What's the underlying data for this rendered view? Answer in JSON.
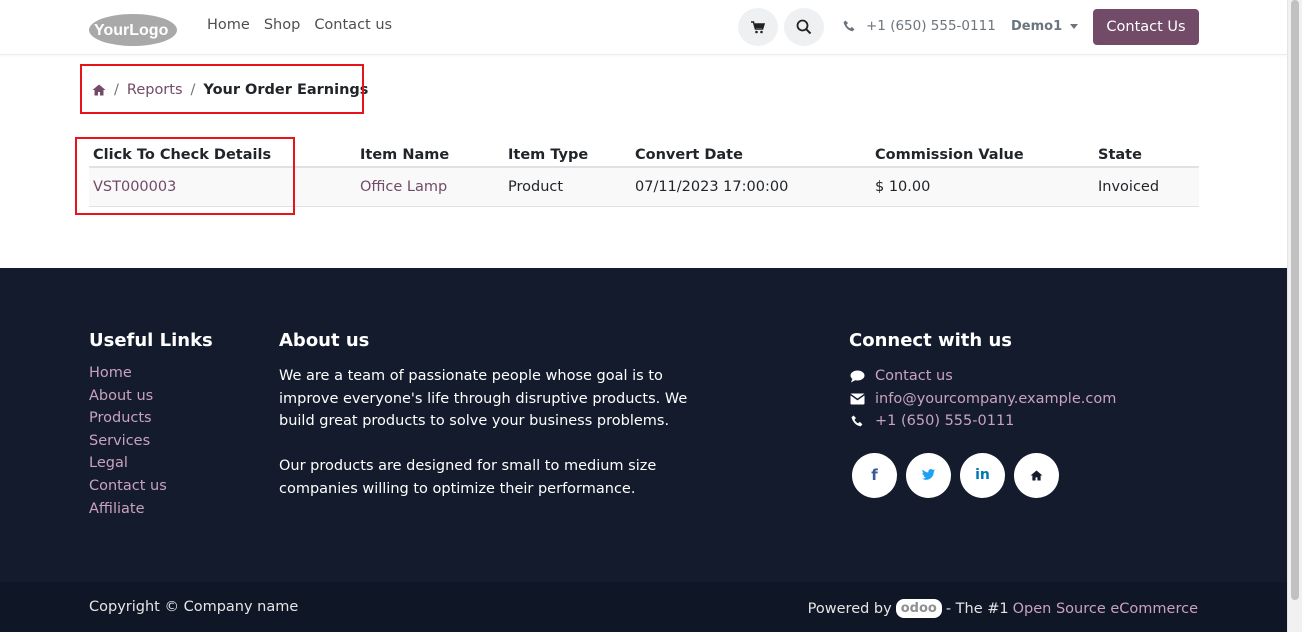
{
  "header": {
    "logo_text": "YourLogo",
    "nav": [
      "Home",
      "Shop",
      "Contact us"
    ],
    "phone": "+1 (650) 555-0111",
    "user": "Demo1",
    "contact_button": "Contact Us"
  },
  "breadcrumb": {
    "items": [
      "Reports",
      "Your Order Earnings"
    ]
  },
  "table": {
    "headers": [
      "Click To Check Details",
      "Item Name",
      "Item Type",
      "Convert Date",
      "Commission Value",
      "State"
    ],
    "rows": [
      [
        "VST000003",
        "Office Lamp",
        "Product",
        "07/11/2023 17:00:00",
        "$ 10.00",
        "Invoiced"
      ]
    ]
  },
  "footer": {
    "useful_links": {
      "title": "Useful Links",
      "items": [
        "Home",
        "About us",
        "Products",
        "Services",
        "Legal",
        "Contact us",
        "Affiliate"
      ]
    },
    "about": {
      "title": "About us",
      "p1": "We are a team of passionate people whose goal is to improve everyone's life through disruptive products. We build great products to solve your business problems.",
      "p2": "Our products are designed for small to medium size companies willing to optimize their performance."
    },
    "connect": {
      "title": "Connect with us",
      "contact": "Contact us",
      "email": "info@yourcompany.example.com",
      "phone": "+1 (650) 555-0111"
    },
    "socials": {
      "facebook": "f",
      "linkedin": "in"
    }
  },
  "copyright": {
    "text": "Copyright © Company name",
    "powered_by": "Powered by",
    "odoo": "odoo",
    "the1": "- The #1",
    "ecommerce": "Open Source eCommerce"
  },
  "colors": {
    "brand": "#714b67",
    "footer_bg": "#131b2c",
    "highlight": "#e8141b",
    "footer_link": "#c9a3be"
  }
}
